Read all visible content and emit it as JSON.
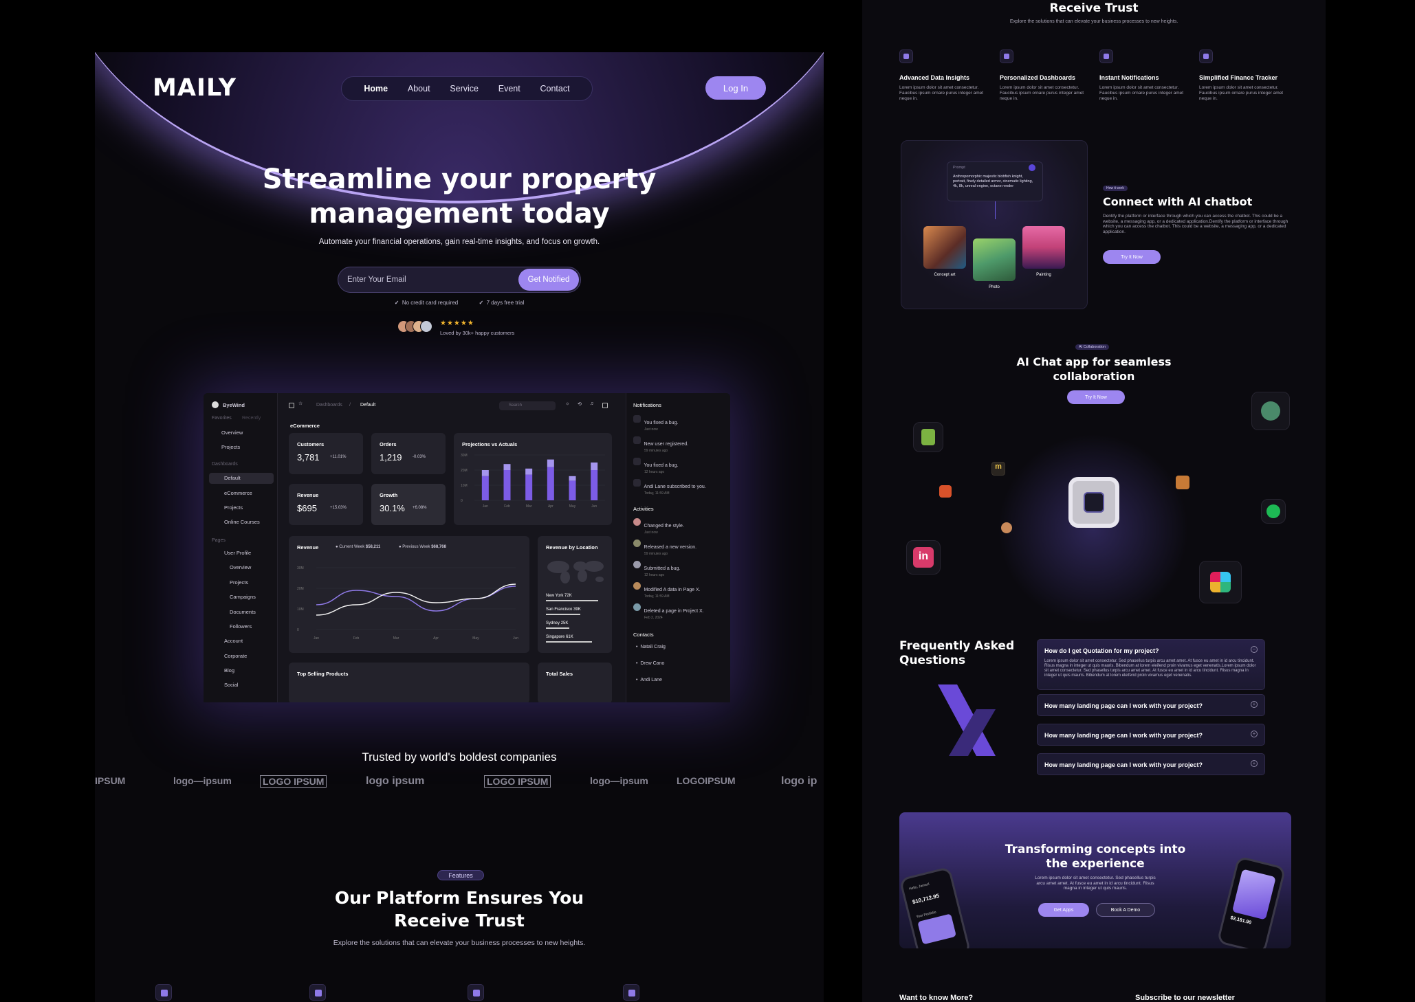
{
  "brand": {
    "name": "MAILY"
  },
  "nav": {
    "items": [
      "Home",
      "About",
      "Service",
      "Event",
      "Contact"
    ],
    "login": "Log In"
  },
  "hero": {
    "title_line1": "Streamline your property",
    "title_line2": "management today",
    "subtitle": "Automate your financial operations, gain real-time insights, and focus on growth.",
    "email_placeholder": "Enter Your Email",
    "cta": "Get Notified",
    "check1": "No credit card required",
    "check2": "7 days free trial",
    "rating_stars": "★★★★★",
    "rating_text": "Loved by 30k+ happy customers"
  },
  "dashboard": {
    "workspace": "ByeWind",
    "tabs": [
      "Favorites",
      "Recently"
    ],
    "favorites": [
      "Overview",
      "Projects"
    ],
    "section_dashboards": "Dashboards",
    "dashboards": [
      "Default",
      "eCommerce",
      "Projects",
      "Online Courses"
    ],
    "section_pages": "Pages",
    "pages": [
      "User Profile",
      "Overview",
      "Projects",
      "Campaigns",
      "Documents",
      "Followers",
      "Account",
      "Corporate",
      "Blog",
      "Social"
    ],
    "breadcrumb": [
      "Dashboards",
      "/",
      "Default"
    ],
    "search_placeholder": "Search",
    "section": "eCommerce",
    "cards": [
      {
        "title": "Customers",
        "value": "3,781",
        "pct": "+11.01%"
      },
      {
        "title": "Orders",
        "value": "1,219",
        "pct": "-0.03%"
      },
      {
        "title": "Revenue",
        "value": "$695",
        "pct": "+15.03%"
      },
      {
        "title": "Growth",
        "value": "30.1%",
        "pct": "+6.08%"
      }
    ],
    "projections_title": "Projections vs Actuals",
    "revenue_title": "Revenue",
    "current_week": "Current Week",
    "current_week_value": "$58,211",
    "previous_week": "Previous Week",
    "previous_week_value": "$68,768",
    "location_title": "Revenue by Location",
    "locations": [
      {
        "city": "New York",
        "value": "72K"
      },
      {
        "city": "San Francisco",
        "value": "39K"
      },
      {
        "city": "Sydney",
        "value": "25K"
      },
      {
        "city": "Singapore",
        "value": "61K"
      }
    ],
    "top_products": "Top Selling Products",
    "total_sales": "Total Sales",
    "notifications_title": "Notifications",
    "notifications": [
      {
        "text": "You fixed a bug.",
        "time": "Just now"
      },
      {
        "text": "New user registered.",
        "time": "59 minutes ago"
      },
      {
        "text": "You fixed a bug.",
        "time": "12 hours ago"
      },
      {
        "text": "Andi Lane subscribed to you.",
        "time": "Today, 11:59 AM"
      }
    ],
    "activities_title": "Activities",
    "activities": [
      {
        "text": "Changed the style.",
        "time": "Just now"
      },
      {
        "text": "Released a new version.",
        "time": "59 minutes ago"
      },
      {
        "text": "Submitted a bug.",
        "time": "12 hours ago"
      },
      {
        "text": "Modified A data in Page X.",
        "time": "Today, 11:59 AM"
      },
      {
        "text": "Deleted a page in Project X.",
        "time": "Feb 2, 2024"
      }
    ],
    "contacts_title": "Contacts",
    "contacts": [
      "Natali Craig",
      "Drew Cano",
      "Andi Lane"
    ]
  },
  "chart_data": [
    {
      "type": "bar",
      "title": "Projections vs Actuals",
      "categories": [
        "Jan",
        "Feb",
        "Mar",
        "Apr",
        "May",
        "Jun"
      ],
      "series": [
        {
          "values": [
            16,
            20,
            17,
            22,
            13,
            20
          ]
        },
        {
          "values": [
            4,
            4,
            4,
            5,
            3,
            5
          ]
        }
      ],
      "yticks": [
        "0",
        "10M",
        "20M",
        "30M"
      ],
      "ylim": [
        0,
        30
      ]
    },
    {
      "type": "line",
      "title": "Revenue",
      "categories": [
        "Jan",
        "Feb",
        "Mar",
        "Apr",
        "May",
        "Jun"
      ],
      "series": [
        {
          "name": "Current Week",
          "values": [
            12,
            19,
            16,
            9,
            15,
            21
          ]
        },
        {
          "name": "Previous Week",
          "values": [
            7,
            12,
            18,
            13,
            15,
            22
          ]
        }
      ],
      "yticks": [
        "0",
        "10M",
        "20M",
        "30M"
      ],
      "ylim": [
        0,
        30
      ]
    }
  ],
  "trusted": {
    "title": "Trusted by world's boldest companies",
    "logos": [
      "IPSUM",
      "logo—ipsum",
      "LOGO IPSUM",
      "logo ipsum",
      "LOGO IPSUM",
      "logo—ipsum",
      "LOGOIPSUM",
      "logo ip"
    ]
  },
  "features": {
    "pill": "Features",
    "title_line1": "Our Platform Ensures You",
    "title_line2": "Receive Trust",
    "subtitle": "Explore the solutions that can elevate your business processes to new heights."
  },
  "right": {
    "top_title": "Receive Trust",
    "top_sub": "Explore the solutions that can elevate your business processes to new heights.",
    "features": [
      {
        "title": "Advanced Data Insights",
        "text": "Lorem ipsum dolor sit amet consectetur. Faucibus ipsum ornare purus integer amet neque in."
      },
      {
        "title": "Personalized Dashboards",
        "text": "Lorem ipsum dolor sit amet consectetur. Faucibus ipsum ornare purus integer amet neque in."
      },
      {
        "title": "Instant Notifications",
        "text": "Lorem ipsum dolor sit amet consectetur. Faucibus ipsum ornare purus integer amet neque in."
      },
      {
        "title": "Simplified Finance Tracker",
        "text": "Lorem ipsum dolor sit amet consectetur. Faucibus ipsum ornare purus integer amet neque in."
      }
    ],
    "prompt_label": "Prompt",
    "prompt_text": "Anthropomorphic majestic blobfish knight, portrait, finely detailed armor, cinematic lighting, 4k, 8k, unreal engine, octane render",
    "image_labels": [
      "Concept art",
      "Photo",
      "Painting"
    ],
    "how_pill": "How it work",
    "chatbot_title": "Connect with AI chatbot",
    "chatbot_text": "Dentify the platform or interface through which you can access the chatbot. This could be a website, a messaging app, or a dedicated application.Dentify the platform or interface through which you can access the chatbot. This could be a website, a messaging app, or a dedicated application.",
    "try_now": "Try It Now",
    "collab_pill": "AI Collaboration",
    "collab_title_line1": "AI Chat app for seamless",
    "collab_title_line2": "collaboration",
    "collab_btn": "Try It Now",
    "faq_title_line1": "Frequently Asked",
    "faq_title_line2": "Questions",
    "faq": [
      {
        "q": "How do I get Quotation for my project?",
        "a": "Lorem ipsum dolor sit amet consectetur. Sed phasellus turpis arcu amet amet. At fusce eu amet in id arcu tincidunt. Risus magna in integer ut quis mauris. Bibendum at lorem eleifend proin vivamus eget venenatis.Lorem ipsum dolor sit amet consectetur. Sed phasellus turpis arcu amet amet. At fusce eu amet in id arcu tincidunt. Risus magna in integer ut quis mauris. Bibendum at lorem eleifend proin vivamus eget venenatis."
      },
      {
        "q": "How many landing page can I work with your project?"
      },
      {
        "q": "How many landing page can I work with your project?"
      },
      {
        "q": "How many landing page can I work with your project?"
      }
    ],
    "cta_title_line1": "Transforming concepts into",
    "cta_title_line2": "the experience",
    "cta_text": "Lorem ipsum dolor sit amet consectetur. Sed phasellus turpis arcu amet amet. At fusce eu amet in id arcu tincidunt. Risus magna in integer ut quis mauris.",
    "get_apps": "Get Apps",
    "book_demo": "Book A Demo",
    "phone_balance": "$10,712.95",
    "phone_greeting": "Hello, Jamesl",
    "phone_portfolio": "Your Portfolio",
    "phone2_value": "$2,181.90",
    "want_more": "Want to know More?",
    "subscribe": "Subscribe to our newsletter"
  },
  "colors": {
    "accent": "#9d86f0",
    "bar": "#7c5ce6",
    "bar_top": "#a595ee",
    "bg": "#09080c"
  }
}
